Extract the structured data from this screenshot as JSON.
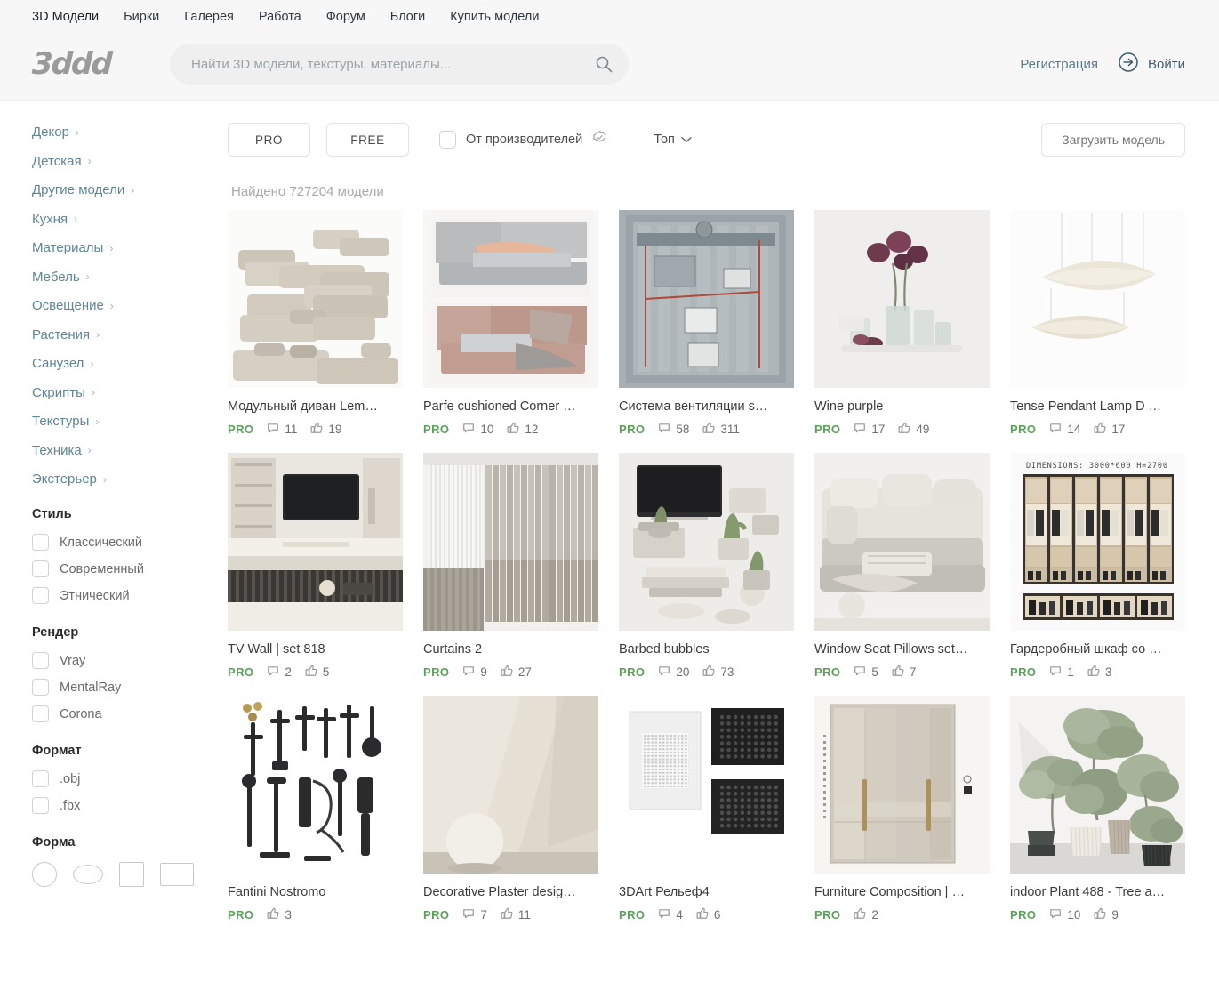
{
  "header": {
    "nav": [
      {
        "label": "3D Модели",
        "active": true
      },
      {
        "label": "Бирки",
        "active": false
      },
      {
        "label": "Галерея",
        "active": false
      },
      {
        "label": "Работа",
        "active": false
      },
      {
        "label": "Форум",
        "active": false
      },
      {
        "label": "Блоги",
        "active": false
      },
      {
        "label": "Купить модели",
        "active": false
      }
    ],
    "logo_text": "3ddd",
    "search_placeholder": "Найти 3D модели, текстуры, материалы...",
    "search_value": "",
    "register_label": "Регистрация",
    "login_label": "Войти",
    "accent_color": "#41788f"
  },
  "sidebar": {
    "categories": [
      {
        "label": "Декор"
      },
      {
        "label": "Детская"
      },
      {
        "label": "Другие модели"
      },
      {
        "label": "Кухня"
      },
      {
        "label": "Материалы"
      },
      {
        "label": "Мебель"
      },
      {
        "label": "Освещение"
      },
      {
        "label": "Растения"
      },
      {
        "label": "Санузел"
      },
      {
        "label": "Скрипты"
      },
      {
        "label": "Текстуры"
      },
      {
        "label": "Техника"
      },
      {
        "label": "Экстерьер"
      }
    ],
    "style_group": {
      "title": "Стиль",
      "options": [
        {
          "label": "Классический",
          "checked": false
        },
        {
          "label": "Современный",
          "checked": false
        },
        {
          "label": "Этнический",
          "checked": false
        }
      ]
    },
    "render_group": {
      "title": "Рендер",
      "options": [
        {
          "label": "Vray",
          "checked": false
        },
        {
          "label": "MentalRay",
          "checked": false
        },
        {
          "label": "Corona",
          "checked": false
        }
      ]
    },
    "format_group": {
      "title": "Формат",
      "options": [
        {
          "label": ".obj",
          "checked": false
        },
        {
          "label": ".fbx",
          "checked": false
        }
      ]
    },
    "shape_group": {
      "title": "Форма",
      "shapes": [
        "circle",
        "ellipse",
        "square",
        "rect"
      ]
    }
  },
  "toolbar": {
    "pro_label": "PRO",
    "free_label": "FREE",
    "maker_label": "От производителей",
    "maker_checked": false,
    "sort_label": "Топ",
    "upload_label": "Загрузить модель"
  },
  "results": {
    "found_text": "Найдено 727204 модели",
    "count": 727204,
    "items": [
      {
        "title": "Модульный диван Lem…",
        "tag": "PRO",
        "comments": 11,
        "likes": 19,
        "thumb": "sofa-modular"
      },
      {
        "title": "Parfe cushioned Corner …",
        "tag": "PRO",
        "comments": 10,
        "likes": 12,
        "thumb": "beds-corner"
      },
      {
        "title": "Система вентиляции s…",
        "tag": "PRO",
        "comments": 58,
        "likes": 311,
        "thumb": "ventilation"
      },
      {
        "title": "Wine purple",
        "tag": "PRO",
        "comments": 17,
        "likes": 49,
        "thumb": "wine-vases"
      },
      {
        "title": "Tense Pendant Lamp D …",
        "tag": "PRO",
        "comments": 14,
        "likes": 17,
        "thumb": "pendant-lamp"
      },
      {
        "title": "TV Wall | set 818",
        "tag": "PRO",
        "comments": 2,
        "likes": 5,
        "thumb": "tv-wall"
      },
      {
        "title": "Curtains 2",
        "tag": "PRO",
        "comments": 9,
        "likes": 27,
        "thumb": "curtains"
      },
      {
        "title": "Barbed bubbles",
        "tag": "PRO",
        "comments": 20,
        "likes": 73,
        "thumb": "desk-cactus"
      },
      {
        "title": "Window Seat Pillows set…",
        "tag": "PRO",
        "comments": 5,
        "likes": 7,
        "thumb": "window-seat"
      },
      {
        "title": "Гардеробный шкаф со …",
        "tag": "PRO",
        "comments": 1,
        "likes": 3,
        "thumb": "wardrobe-open",
        "caption": "DIMENSIONS: 3000*600 H=2700"
      },
      {
        "title": "Fantini Nostromo",
        "tag": "PRO",
        "comments": null,
        "likes": 3,
        "thumb": "faucets"
      },
      {
        "title": "Decorative Plaster desig…",
        "tag": "PRO",
        "comments": 7,
        "likes": 11,
        "thumb": "plaster"
      },
      {
        "title": "3DArt Рельеф4",
        "tag": "PRO",
        "comments": 4,
        "likes": 6,
        "thumb": "relief-panels"
      },
      {
        "title": "Furniture Composition | …",
        "tag": "PRO",
        "comments": null,
        "likes": 2,
        "thumb": "wardrobe-closed"
      },
      {
        "title": "indoor Plant 488 - Tree a…",
        "tag": "PRO",
        "comments": 10,
        "likes": 9,
        "thumb": "indoor-plants"
      }
    ]
  }
}
